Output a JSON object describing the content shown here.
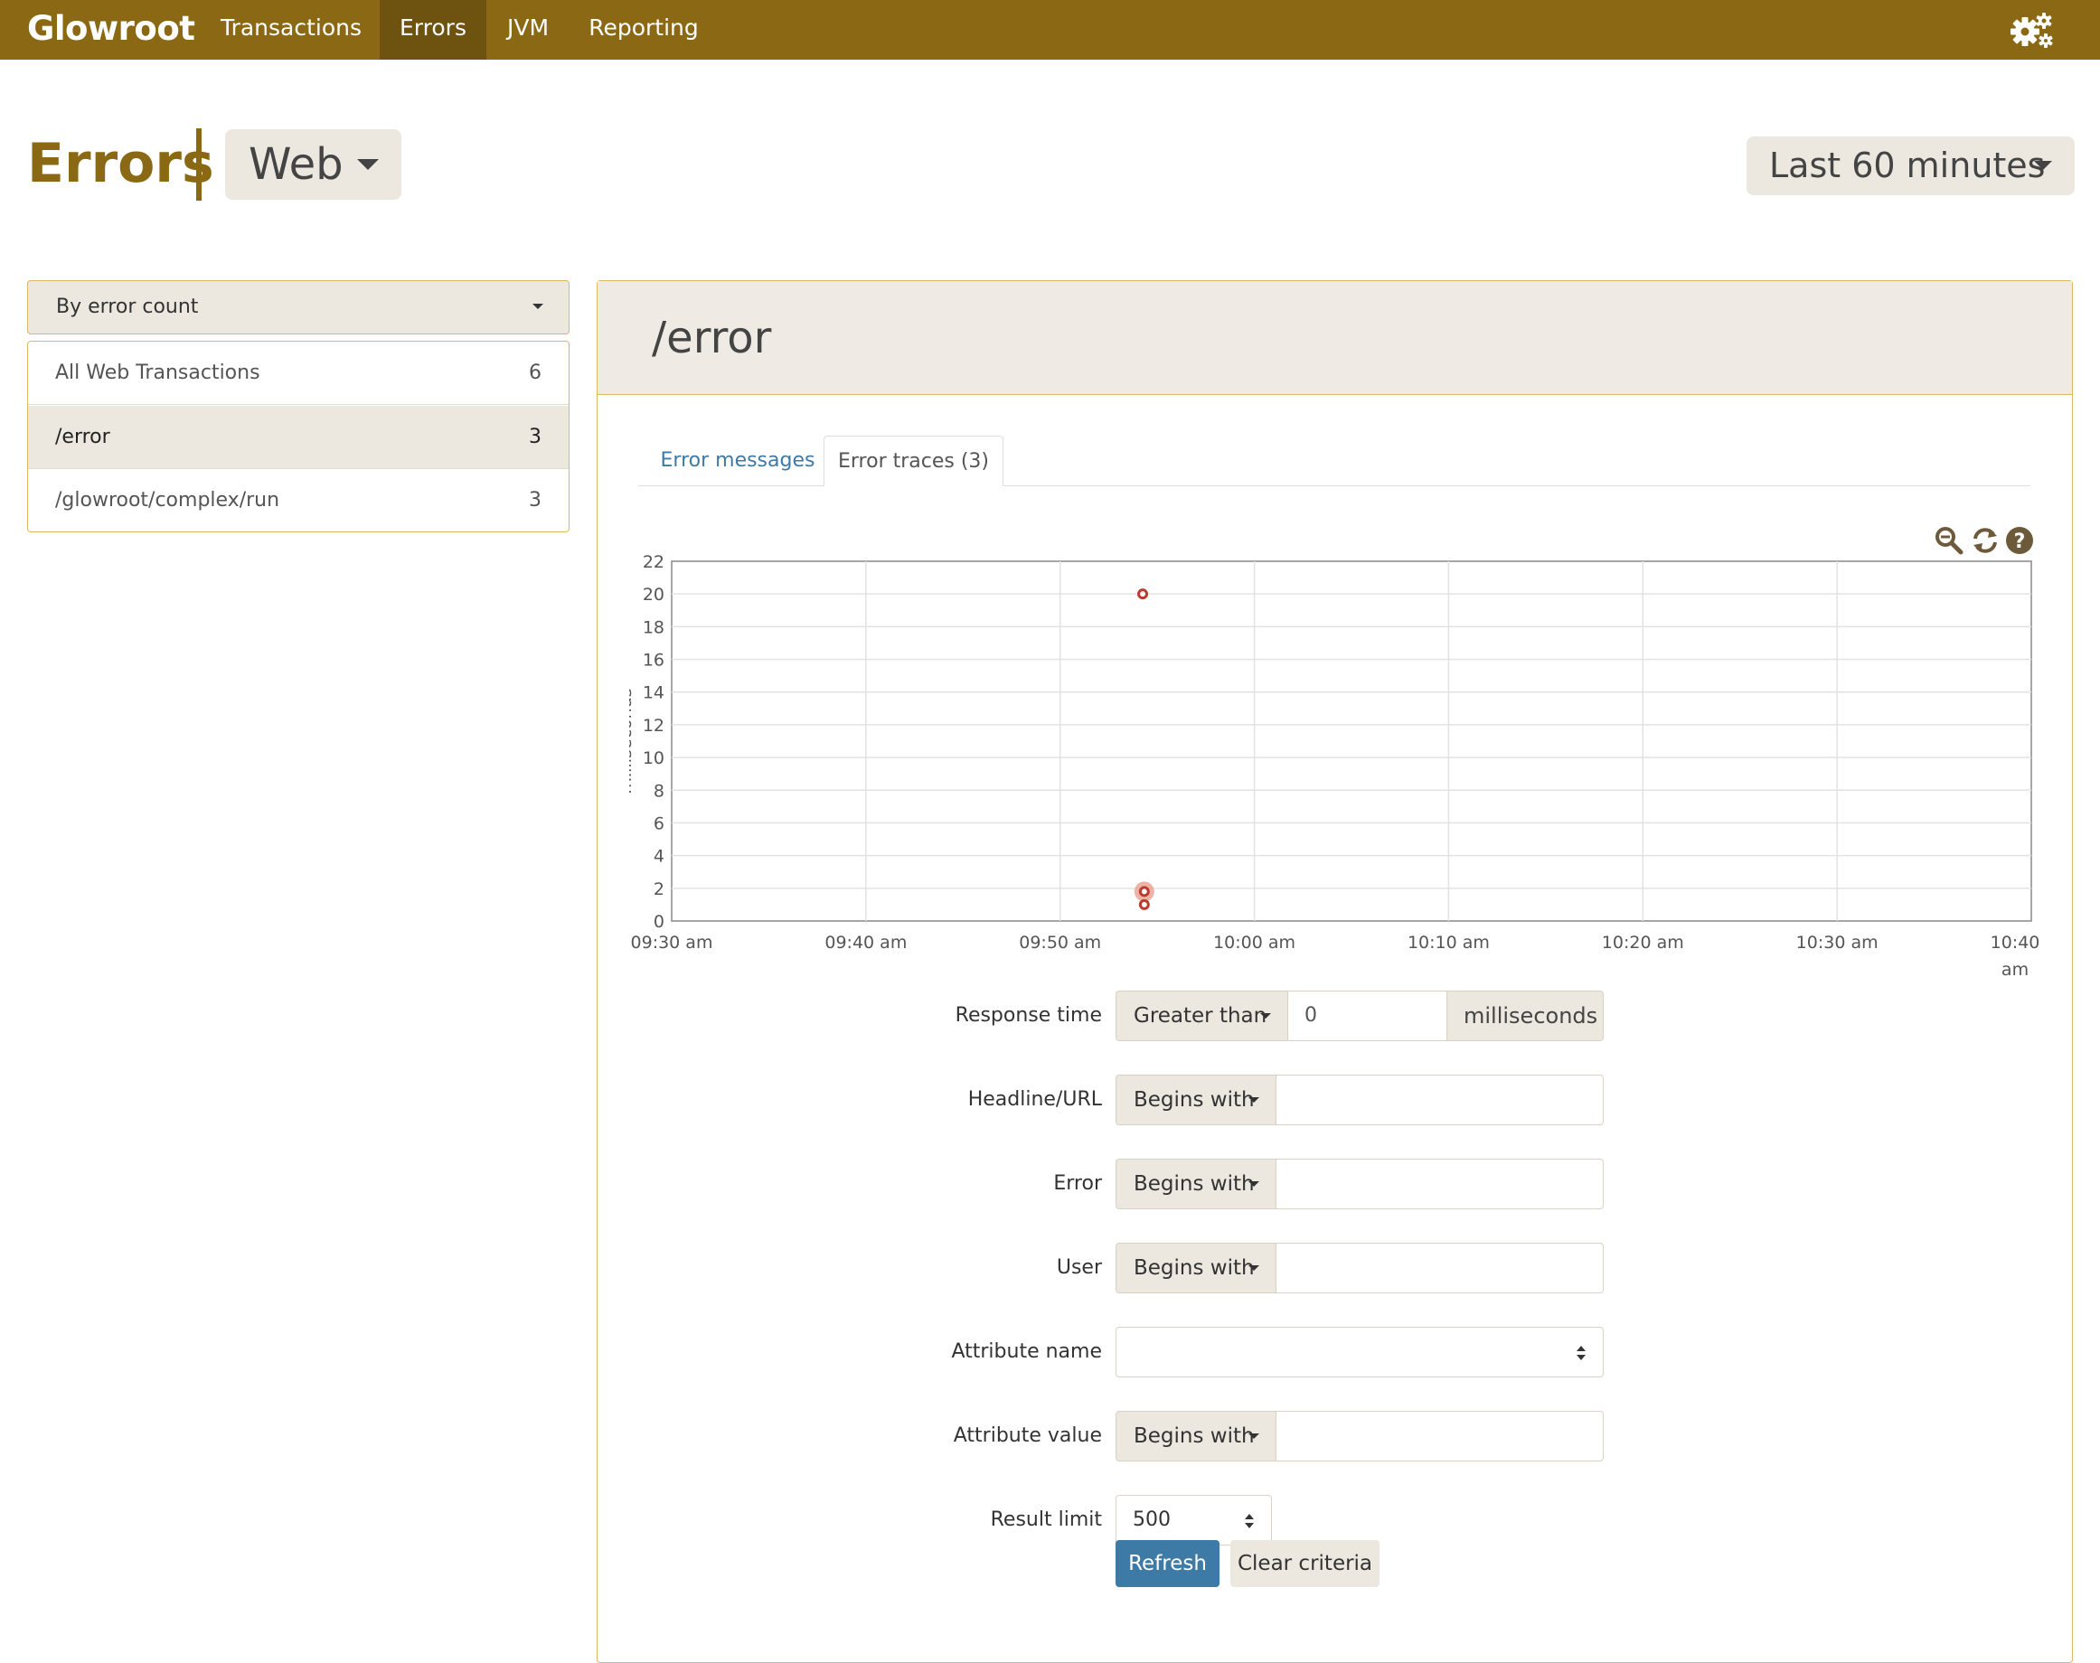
{
  "navbar": {
    "brand": "Glowroot",
    "items": [
      {
        "label": "Transactions"
      },
      {
        "label": "Errors"
      },
      {
        "label": "JVM"
      },
      {
        "label": "Reporting"
      }
    ],
    "accent_color": "#8b6914"
  },
  "header": {
    "title": "Errors",
    "agent_rollup": "Web",
    "time_range": "Last 60 minutes"
  },
  "sidebar": {
    "sort_by": "By error count",
    "transactions": [
      {
        "name": "All Web Transactions",
        "count": "6"
      },
      {
        "name": "/error",
        "count": "3"
      },
      {
        "name": "/glowroot/complex/run",
        "count": "3"
      }
    ]
  },
  "main": {
    "title": "/error",
    "tabs": [
      {
        "label": "Error messages"
      },
      {
        "label": "Error traces (3)"
      }
    ]
  },
  "chart_data": {
    "type": "scatter",
    "ylabel": "milliseconds",
    "ylim": [
      0,
      22
    ],
    "yticks": [
      "0",
      "2",
      "4",
      "6",
      "8",
      "10",
      "12",
      "14",
      "16",
      "18",
      "20",
      "22"
    ],
    "xticks": [
      "09:30 am",
      "09:40 am",
      "09:50 am",
      "10:00 am",
      "10:10 am",
      "10:20 am",
      "10:30 am",
      "10:40 am"
    ],
    "xlim_minutes": [
      0,
      70
    ],
    "points": [
      {
        "x": "09:54:15 am",
        "y": 20
      },
      {
        "x": "09:54:20 am",
        "y": 1.8
      },
      {
        "x": "09:54:20 am",
        "y": 1.0
      }
    ],
    "grid": true,
    "point_color": "#c0392b"
  },
  "filters": {
    "response_time": {
      "label": "Response time",
      "operator": "Greater than",
      "value": "0",
      "unit": "milliseconds"
    },
    "headline": {
      "label": "Headline/URL",
      "operator": "Begins with",
      "value": ""
    },
    "error": {
      "label": "Error",
      "operator": "Begins with",
      "value": ""
    },
    "user": {
      "label": "User",
      "operator": "Begins with",
      "value": ""
    },
    "attribute_name": {
      "label": "Attribute name",
      "value": ""
    },
    "attribute_value": {
      "label": "Attribute value",
      "operator": "Begins with",
      "value": ""
    },
    "result_limit": {
      "label": "Result limit",
      "value": "500"
    },
    "refresh_label": "Refresh",
    "clear_label": "Clear criteria"
  }
}
